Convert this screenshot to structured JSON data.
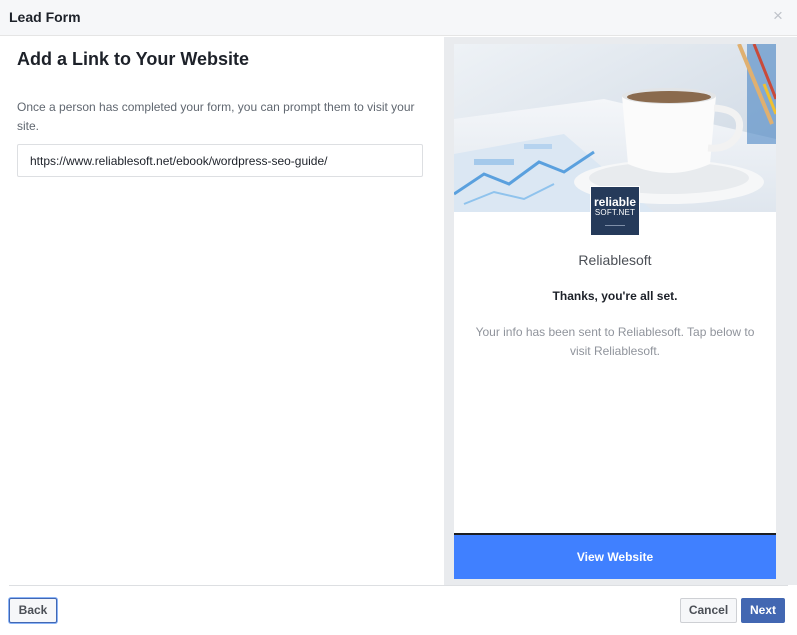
{
  "header": {
    "title": "Lead Form",
    "close_icon": "×"
  },
  "section": {
    "title": "Add a Link to Your Website",
    "help_text": "Once a person has completed your form, you can prompt them to visit your site.",
    "url_value": "https://www.reliablesoft.net/ebook/wordpress-seo-guide/"
  },
  "preview": {
    "logo_top": "reliable",
    "logo_bottom": "SOFT.NET",
    "company_name": "Reliablesoft",
    "thanks_heading": "Thanks, you're all set.",
    "info_text": "Your info has been sent to Reliablesoft. Tap below to visit Reliablesoft.",
    "button_label": "View Website",
    "button_color": "#4080ff"
  },
  "footer": {
    "back_label": "Back",
    "cancel_label": "Cancel",
    "next_label": "Next",
    "primary_color": "#4267b2"
  }
}
